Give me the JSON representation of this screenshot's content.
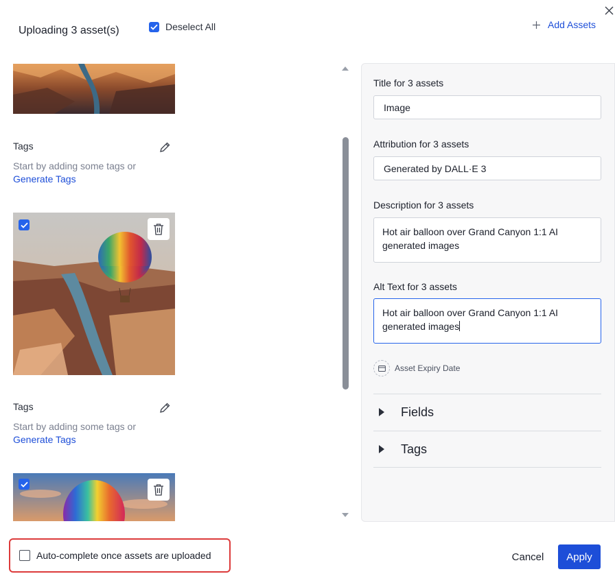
{
  "header": {
    "title": "Uploading 3 asset(s)",
    "deselect_label": "Deselect All",
    "add_assets_label": "Add Assets"
  },
  "assets": [
    {
      "tags_title": "Tags",
      "tags_hint": "Start by adding some tags or",
      "generate_tags": "Generate Tags"
    },
    {
      "tags_title": "Tags",
      "tags_hint": "Start by adding some tags or",
      "generate_tags": "Generate Tags"
    }
  ],
  "form": {
    "title_label": "Title for 3 assets",
    "title_value": "Image",
    "attribution_label": "Attribution for 3 assets",
    "attribution_value": "Generated by DALL·E 3",
    "description_label": "Description for 3 assets",
    "description_value": "Hot air balloon over Grand Canyon 1:1 AI generated images",
    "alt_label": "Alt Text for 3 assets",
    "alt_value": "Hot air balloon over Grand Canyon 1:1 AI generated images",
    "expiry_label": "Asset Expiry Date",
    "sections": [
      "Fields",
      "Tags"
    ]
  },
  "footer": {
    "auto_complete_label": "Auto-complete once assets are uploaded",
    "cancel_label": "Cancel",
    "apply_label": "Apply"
  },
  "colors": {
    "accent": "#1d4ed8",
    "highlight_border": "#dc3a3a"
  }
}
